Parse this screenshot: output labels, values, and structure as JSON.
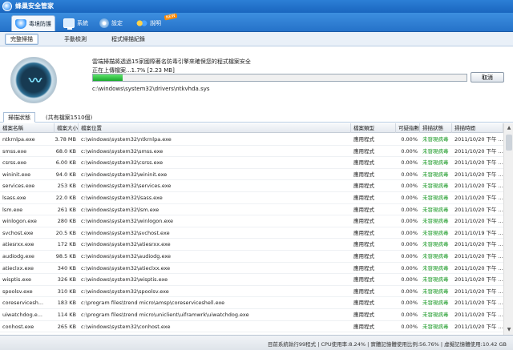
{
  "window": {
    "title": "蜂巢安全管家"
  },
  "topbar": {
    "tabs": [
      {
        "label": "毒境防護",
        "icon": "shield-icon"
      },
      {
        "label": "系統",
        "icon": "monitor-icon"
      },
      {
        "label": "設定",
        "icon": "gear-icon"
      },
      {
        "label": "說明",
        "icon": "people-icon"
      }
    ],
    "badge": "NEW"
  },
  "subtabs": [
    "完整掃描",
    "手動檢測",
    "程式掃描紀錄"
  ],
  "scan": {
    "headline": "雲端掃描將透過15家國際著名防毒引擎來確保您的程式檔案安全",
    "progress_text": "正在上傳檔案...1.7% [2.23 MB]",
    "progress_fraction": 0.079,
    "cancel_label": "取消",
    "current_file": "c:\\windows\\system32\\drivers\\ntkvhda.sys"
  },
  "list_tabs": [
    "掃描狀態",
    "(共有檔案1510個)"
  ],
  "table": {
    "columns": [
      "檔案名稱",
      "檔案大小",
      "檔案位置",
      "檔案類型",
      "可疑指數",
      "掃描狀態",
      "掃描時間"
    ],
    "rows": [
      [
        "ntkrnlpa.exe",
        "3.78 MB",
        "c:\\windows\\system32\\ntkrnlpa.exe",
        "應用程式",
        "0.00%",
        "未發現病毒",
        "2011/10/20 下午 ..."
      ],
      [
        "smss.exe",
        "68.0 KB",
        "c:\\windows\\system32\\smss.exe",
        "應用程式",
        "0.00%",
        "未發現病毒",
        "2011/10/20 下午 ..."
      ],
      [
        "csrss.exe",
        "6.00 KB",
        "c:\\windows\\system32\\csrss.exe",
        "應用程式",
        "0.00%",
        "未發現病毒",
        "2011/10/20 下午 ..."
      ],
      [
        "wininit.exe",
        "94.0 KB",
        "c:\\windows\\system32\\wininit.exe",
        "應用程式",
        "0.00%",
        "未發現病毒",
        "2011/10/20 下午 ..."
      ],
      [
        "services.exe",
        "253 KB",
        "c:\\windows\\system32\\services.exe",
        "應用程式",
        "0.00%",
        "未發現病毒",
        "2011/10/20 下午 ..."
      ],
      [
        "lsass.exe",
        "22.0 KB",
        "c:\\windows\\system32\\lsass.exe",
        "應用程式",
        "0.00%",
        "未發現病毒",
        "2011/10/20 下午 ..."
      ],
      [
        "lsm.exe",
        "261 KB",
        "c:\\windows\\system32\\lsm.exe",
        "應用程式",
        "0.00%",
        "未發現病毒",
        "2011/10/20 下午 ..."
      ],
      [
        "winlogon.exe",
        "280 KB",
        "c:\\windows\\system32\\winlogon.exe",
        "應用程式",
        "0.00%",
        "未發現病毒",
        "2011/10/20 下午 ..."
      ],
      [
        "svchost.exe",
        "20.5 KB",
        "c:\\windows\\system32\\svchost.exe",
        "應用程式",
        "0.00%",
        "未發現病毒",
        "2011/10/19 下午 ..."
      ],
      [
        "atiesrxx.exe",
        "172 KB",
        "c:\\windows\\system32\\atiesrxx.exe",
        "應用程式",
        "0.00%",
        "未發現病毒",
        "2011/10/20 下午 ..."
      ],
      [
        "audiodg.exe",
        "98.5 KB",
        "c:\\windows\\system32\\audiodg.exe",
        "應用程式",
        "0.00%",
        "未發現病毒",
        "2011/10/20 下午 ..."
      ],
      [
        "atieclxx.exe",
        "340 KB",
        "c:\\windows\\system32\\atieclxx.exe",
        "應用程式",
        "0.00%",
        "未發現病毒",
        "2011/10/20 下午 ..."
      ],
      [
        "wisptis.exe",
        "326 KB",
        "c:\\windows\\system32\\wisptis.exe",
        "應用程式",
        "0.00%",
        "未發現病毒",
        "2011/10/20 下午 ..."
      ],
      [
        "spoolsv.exe",
        "310 KB",
        "c:\\windows\\system32\\spoolsv.exe",
        "應用程式",
        "0.00%",
        "未發現病毒",
        "2011/10/20 下午 ..."
      ],
      [
        "coreservicesh...",
        "183 KB",
        "c:\\program files\\trend micro\\amsp\\coreserviceshell.exe",
        "應用程式",
        "0.00%",
        "未發現病毒",
        "2011/10/20 下午 ..."
      ],
      [
        "uiwatchdog.e...",
        "114 KB",
        "c:\\program files\\trend micro\\uniclient\\uiframwrk\\uiwatchdog.exe",
        "應用程式",
        "0.00%",
        "未發現病毒",
        "2011/10/20 下午 ..."
      ],
      [
        "conhost.exe",
        "265 KB",
        "c:\\windows\\system32\\conhost.exe",
        "應用程式",
        "0.00%",
        "未發現病毒",
        "2011/10/20 下午 ..."
      ]
    ]
  },
  "status": {
    "text": "目前系統執行99程式 | CPU使用率:8.24% | 實體記憶體使用比例:56.76% | 虛擬記憶體使用:10.42 GB"
  },
  "colors": {
    "accent": "#2572c9",
    "ok": "#1c9a28",
    "progress": "#19a82b"
  }
}
